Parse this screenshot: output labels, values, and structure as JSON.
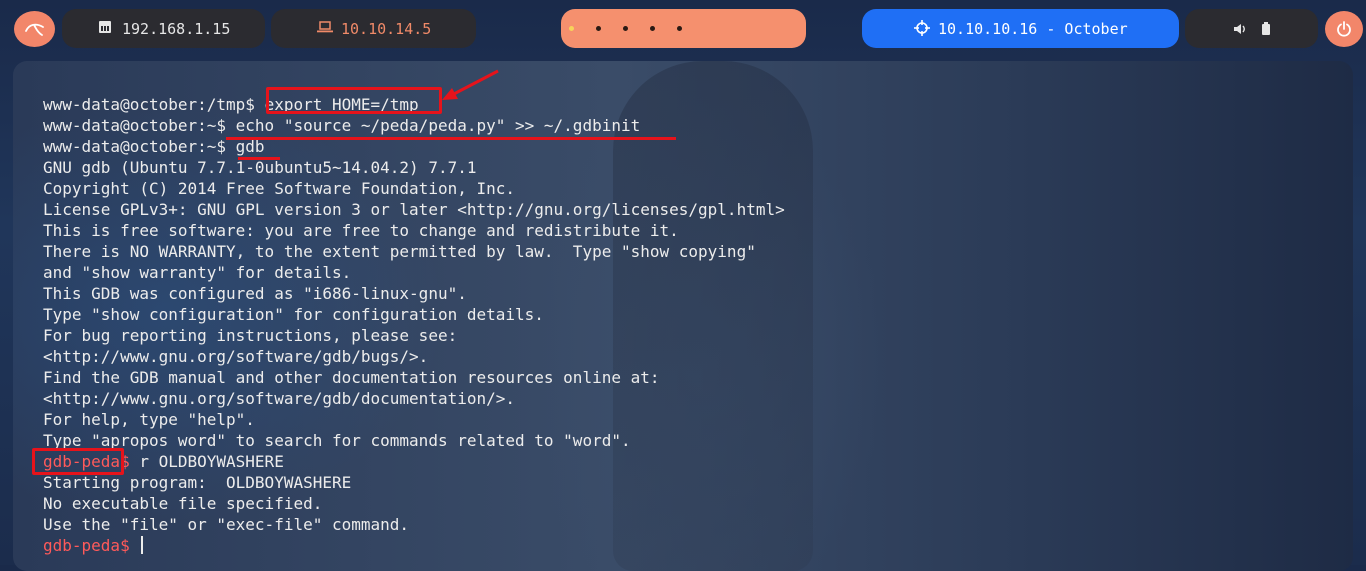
{
  "topbar": {
    "local_ip": "192.168.1.15",
    "vpn_ip": "10.10.14.5",
    "target": "10.10.10.16 - October",
    "workspace_count": 5,
    "colors": {
      "accent": "#f2866a",
      "target_bg": "#1f6ff5",
      "pill_bg": "#2b2b30"
    }
  },
  "terminal": {
    "lines": [
      {
        "prompt": "www-data@october:/tmp$ ",
        "text": "export HOME=/tmp"
      },
      {
        "prompt": "www-data@october:~$ ",
        "text": "echo \"source ~/peda/peda.py\" >> ~/.gdbinit"
      },
      {
        "prompt": "www-data@october:~$ ",
        "text": "gdb"
      },
      {
        "prompt": "",
        "text": "GNU gdb (Ubuntu 7.7.1-0ubuntu5~14.04.2) 7.7.1"
      },
      {
        "prompt": "",
        "text": "Copyright (C) 2014 Free Software Foundation, Inc."
      },
      {
        "prompt": "",
        "text": "License GPLv3+: GNU GPL version 3 or later <http://gnu.org/licenses/gpl.html>"
      },
      {
        "prompt": "",
        "text": "This is free software: you are free to change and redistribute it."
      },
      {
        "prompt": "",
        "text": "There is NO WARRANTY, to the extent permitted by law.  Type \"show copying\""
      },
      {
        "prompt": "",
        "text": "and \"show warranty\" for details."
      },
      {
        "prompt": "",
        "text": "This GDB was configured as \"i686-linux-gnu\"."
      },
      {
        "prompt": "",
        "text": "Type \"show configuration\" for configuration details."
      },
      {
        "prompt": "",
        "text": "For bug reporting instructions, please see:"
      },
      {
        "prompt": "",
        "text": "<http://www.gnu.org/software/gdb/bugs/>."
      },
      {
        "prompt": "",
        "text": "Find the GDB manual and other documentation resources online at:"
      },
      {
        "prompt": "",
        "text": "<http://www.gnu.org/software/gdb/documentation/>."
      },
      {
        "prompt": "",
        "text": "For help, type \"help\"."
      },
      {
        "prompt": "",
        "text": "Type \"apropos word\" to search for commands related to \"word\"."
      },
      {
        "prompt": "gdb-peda",
        "suffix": "$ ",
        "text": "r OLDBOYWASHERE"
      },
      {
        "prompt": "",
        "text": "Starting program:  OLDBOYWASHERE"
      },
      {
        "prompt": "",
        "text": "No executable file specified."
      },
      {
        "prompt": "",
        "text": "Use the \"file\" or \"exec-file\" command."
      },
      {
        "prompt": "gdb-peda",
        "suffix": "$ ",
        "text": ""
      }
    ]
  },
  "icons": {
    "kali": "kali-dragon-icon",
    "local": "ethernet-icon",
    "vpn": "laptop-icon",
    "target": "crosshair-icon",
    "volume": "volume-icon",
    "battery": "battery-icon",
    "power": "power-icon"
  }
}
